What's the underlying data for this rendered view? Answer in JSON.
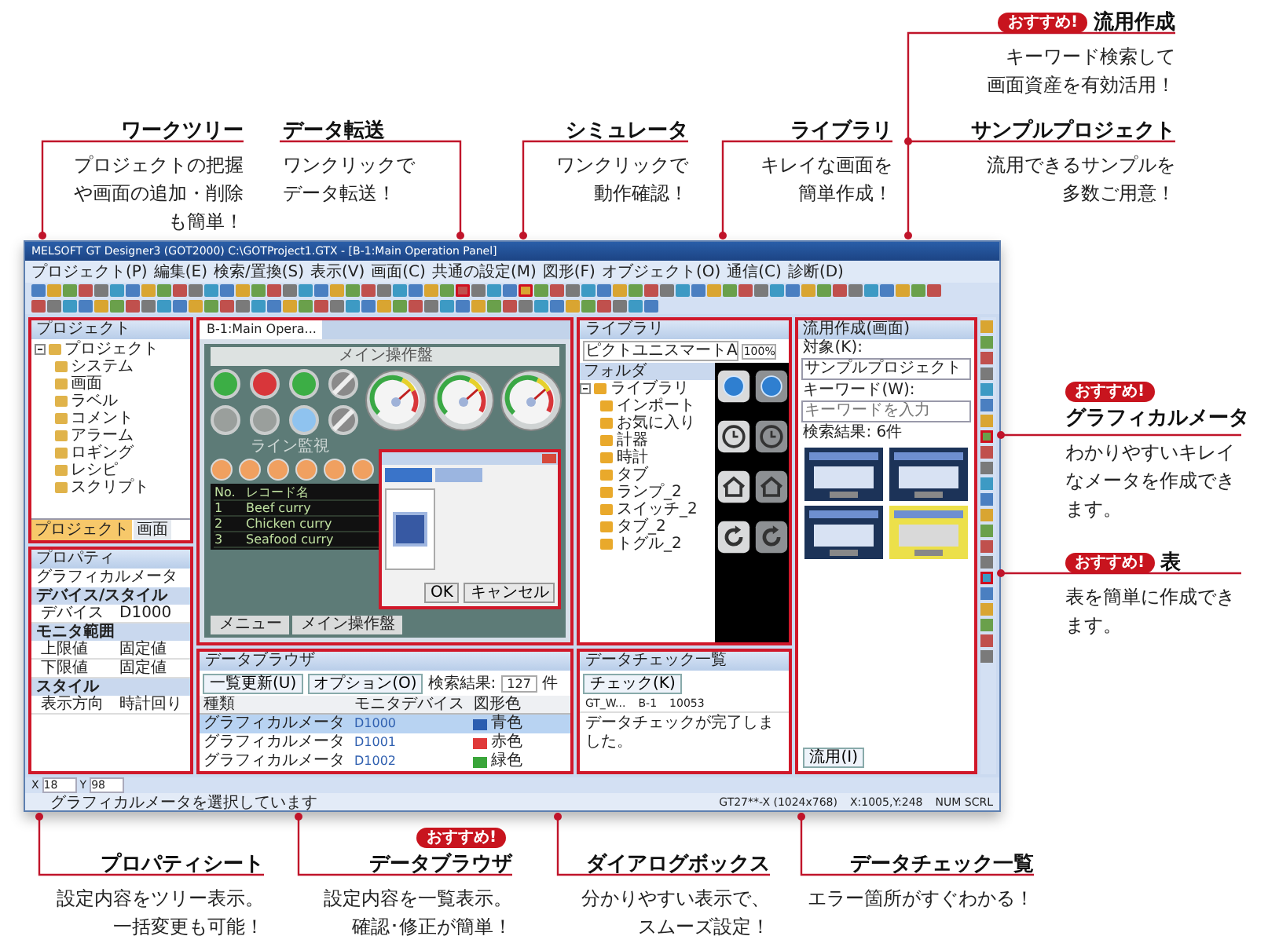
{
  "callouts": [
    {
      "title": "ワークツリー",
      "lines": [
        "プロジェクトの把握",
        "や画面の追加・削除",
        "も簡単！"
      ]
    },
    {
      "title": "データ転送",
      "lines": [
        "ワンクリックで",
        "データ転送！"
      ]
    },
    {
      "title": "シミュレータ",
      "lines": [
        "ワンクリックで",
        "動作確認！"
      ]
    },
    {
      "title": "ライブラリ",
      "lines": [
        "キレイな画面を",
        "簡単作成！"
      ]
    },
    {
      "title": "流用作成",
      "badge": "おすすめ!",
      "lines": [
        "キーワード検索して",
        "画面資産を有効活用！"
      ]
    },
    {
      "title": "サンプルプロジェクト",
      "lines": [
        "流用できるサンプルを",
        "多数ご用意！"
      ]
    },
    {
      "title": "グラフィカルメータ",
      "badge": "おすすめ!",
      "lines": [
        "わかりやすいキレイ",
        "なメータを作成でき",
        "ます。"
      ]
    },
    {
      "title": "表",
      "badge": "おすすめ!",
      "lines": [
        "表を簡単に作成でき",
        "ます。"
      ]
    },
    {
      "title": "プロパティシート",
      "lines": [
        "設定内容をツリー表示。",
        "一括変更も可能！"
      ]
    },
    {
      "title": "データブラウザ",
      "badge": "おすすめ!",
      "lines": [
        "設定内容を一覧表示。",
        "確認･修正が簡単！"
      ]
    },
    {
      "title": "ダイアログボックス",
      "lines": [
        "分かりやすい表示で、",
        "スムーズ設定！"
      ]
    },
    {
      "title": "データチェック一覧",
      "lines": [
        "エラー箇所がすぐわかる！"
      ]
    }
  ],
  "app": {
    "title": "MELSOFT GT Designer3 (GOT2000) C:\\GOTProject1.GTX - [B-1:Main Operation Panel]",
    "menus": [
      "プロジェクト(P)",
      "編集(E)",
      "検索/置換(S)",
      "表示(V)",
      "画面(C)",
      "共通の設定(M)",
      "図形(F)",
      "オブジェクト(O)",
      "通信(C)",
      "診断(D)"
    ],
    "project": {
      "title": "プロジェクト",
      "tree": [
        {
          "label": "プロジェクト",
          "expanded": true,
          "children": [
            {
              "label": "システム"
            },
            {
              "label": "画面"
            },
            {
              "label": "ラベル"
            },
            {
              "label": "コメント"
            },
            {
              "label": "アラーム"
            },
            {
              "label": "ロギング"
            },
            {
              "label": "レシピ"
            },
            {
              "label": "スクリプト"
            }
          ]
        }
      ],
      "tabs": [
        {
          "label": "プロジェクト",
          "selected": true
        },
        {
          "label": "画面",
          "selected": false
        }
      ]
    },
    "property": {
      "title": "プロパティ",
      "object": "グラフィカルメータ",
      "rows": [
        {
          "kind": "section",
          "label": "デバイス/スタイル"
        },
        {
          "kind": "field",
          "label": "デバイス",
          "value": "D1000"
        },
        {
          "kind": "section",
          "label": "モニタ範囲"
        },
        {
          "kind": "field",
          "label": "上限値",
          "value": "固定値"
        },
        {
          "kind": "field",
          "label": "下限値",
          "value": "固定値"
        },
        {
          "kind": "section",
          "label": "スタイル"
        },
        {
          "kind": "field",
          "label": "表示方向",
          "value": "時計回り"
        }
      ]
    },
    "editor": {
      "tab": "B-1:Main Opera...",
      "screen_title": "メイン操作盤",
      "section": "ライン監視",
      "lamps": [
        {
          "kind": "lamp",
          "color": "#3cae45"
        },
        {
          "kind": "lamp",
          "color": "#d8363a"
        },
        {
          "kind": "lamp",
          "color": "#3cae45"
        },
        {
          "kind": "switch",
          "color": "#8a8a8a"
        },
        {
          "kind": "lamp",
          "color": "#9a9f9c"
        },
        {
          "kind": "lamp",
          "color": "#9a9f9c"
        },
        {
          "kind": "lamp",
          "color": "#8fc3ef"
        },
        {
          "kind": "switch",
          "color": "#8a8a8a"
        }
      ],
      "record_header": [
        "No.",
        "レコード名"
      ],
      "records": [
        [
          "1",
          "Beef curry"
        ],
        [
          "2",
          "Chicken curry"
        ],
        [
          "3",
          "Seafood curry"
        ]
      ],
      "buttons": [
        "メニュー",
        "メイン操作盤"
      ],
      "dialog": {
        "buttons": [
          "OK",
          "キャンセル"
        ]
      }
    },
    "browser": {
      "title": "データブラウザ",
      "refresh": "一覧更新(U)",
      "option": "オプション(O)",
      "result_label": "検索結果:",
      "result": "127",
      "unit": "件",
      "columns": [
        "種類",
        "モニタデバイス",
        "図形色"
      ],
      "rows": [
        {
          "type": "グラフィカルメータ",
          "device": "D1000",
          "color_name": "青色",
          "color": "#2a5db0",
          "selected": true
        },
        {
          "type": "グラフィカルメータ",
          "device": "D1001",
          "color_name": "赤色",
          "color": "#e03a3a",
          "selected": false
        },
        {
          "type": "グラフィカルメータ",
          "device": "D1002",
          "color_name": "緑色",
          "color": "#3aa53a",
          "selected": false
        }
      ]
    },
    "library": {
      "title": "ライブラリ",
      "category": "ピクトユニスマートA",
      "zoom": "100%",
      "folder_title": "フォルダ",
      "folders": [
        {
          "label": "ライブラリ",
          "expanded": true,
          "children": [
            {
              "label": "インポート"
            },
            {
              "label": "お気に入り"
            },
            {
              "label": "計器"
            },
            {
              "label": "時計"
            },
            {
              "label": "タブ"
            },
            {
              "label": "ランプ_2"
            },
            {
              "label": "スイッチ_2"
            },
            {
              "label": "タブ_2"
            },
            {
              "label": "トグル_2"
            }
          ]
        }
      ]
    },
    "check": {
      "title": "データチェック一覧",
      "button": "チェック(K)",
      "row": {
        "id": "GT_W...",
        "screen": "B-1",
        "code": "10053"
      },
      "result": "データチェックが完了しました。"
    },
    "sample": {
      "title": "流用作成(画面)",
      "target_label": "対象(K):",
      "target": "サンプルプロジェクト",
      "keyword_label": "キーワード(W):",
      "keyword_placeholder": "キーワードを入力",
      "result": "検索結果: 6件",
      "button": "流用(I)"
    },
    "status": {
      "coords": [
        {
          "label": "X",
          "value": "18"
        },
        {
          "label": "Y",
          "value": "98"
        }
      ],
      "message": "グラフィカルメータを選択しています",
      "model": "GT27**-X (1024x768)",
      "position": "X:1005,Y:248",
      "keys": "NUM SCRL"
    }
  }
}
